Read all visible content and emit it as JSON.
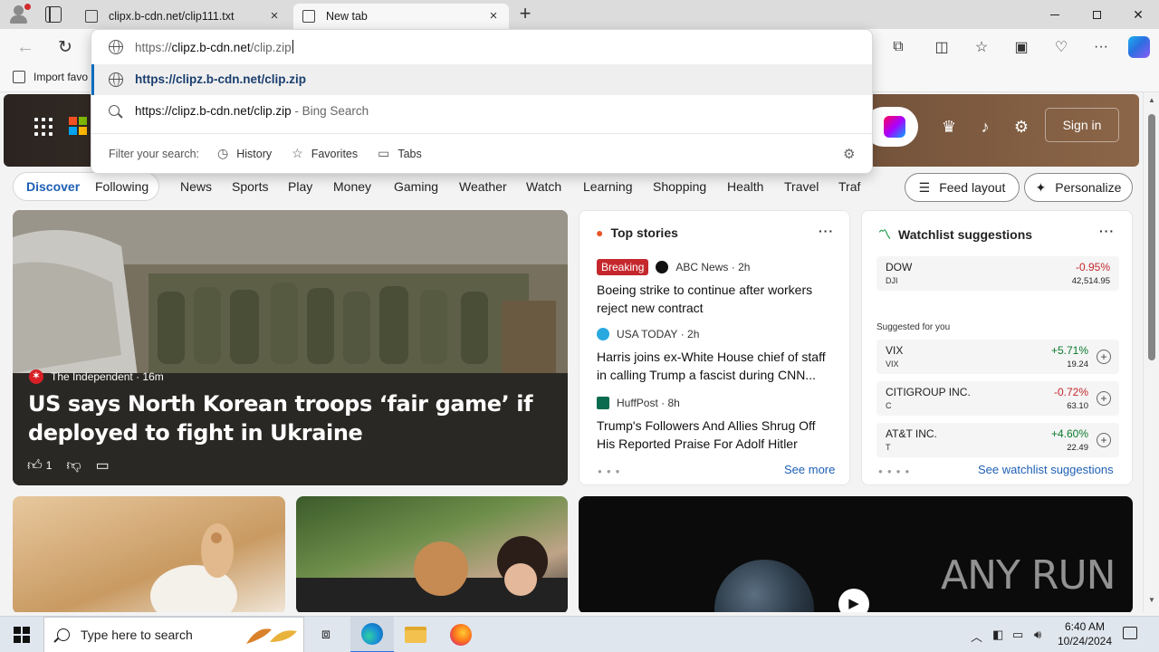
{
  "browser": {
    "tabs": [
      {
        "title": "clipx.b-cdn.net/clip111.txt"
      },
      {
        "title": "New tab"
      }
    ],
    "favorites_bar": {
      "import_label": "Import favo"
    },
    "address": {
      "prefix": "https://",
      "host": "clipz.b-cdn.net",
      "path": "/clip.zip"
    },
    "suggestions": [
      {
        "text": "https://clipz.b-cdn.net/clip.zip"
      },
      {
        "text": "https://clipz.b-cdn.net/clip.zip",
        "suffix": " - Bing Search"
      }
    ],
    "filter": {
      "label": "Filter your search:",
      "options": [
        "History",
        "Favorites",
        "Tabs"
      ]
    }
  },
  "page": {
    "sign_in": "Sign in",
    "feed_tabs": {
      "discover": "Discover",
      "following": "Following"
    },
    "categories": [
      "News",
      "Sports",
      "Play",
      "Money",
      "Gaming",
      "Weather",
      "Watch",
      "Learning",
      "Shopping",
      "Health",
      "Travel",
      "Traf"
    ],
    "buttons": {
      "feed_layout": "Feed layout",
      "personalize": "Personalize"
    },
    "hero": {
      "source": "The Independent",
      "age": "16m",
      "title": "US says North Korean troops ‘fair game’ if deployed to fight in Ukraine",
      "likes": "1"
    },
    "top_stories": {
      "heading": "Top stories",
      "items": [
        {
          "badge": "Breaking",
          "source": "ABC News",
          "age": "2h",
          "title": "Boeing strike to continue after workers reject new contract"
        },
        {
          "source": "USA TODAY",
          "age": "2h",
          "title": "Harris joins ex-White House chief of staff in calling Trump a fascist during CNN..."
        },
        {
          "source": "HuffPost",
          "age": "8h",
          "title": "Trump's Followers And Allies Shrug Off His Reported Praise For Adolf Hitler"
        }
      ],
      "see_more": "See more"
    },
    "watchlist": {
      "heading": "Watchlist suggestions",
      "suggested_label": "Suggested for you",
      "items": [
        {
          "name": "DOW",
          "symbol": "DJI",
          "change": "-0.95%",
          "price": "42,514.95"
        },
        {
          "name": "VIX",
          "symbol": "VIX",
          "change": "+5.71%",
          "price": "19.24"
        },
        {
          "name": "CITIGROUP INC.",
          "symbol": "C",
          "change": "-0.72%",
          "price": "63.10"
        },
        {
          "name": "AT&T INC.",
          "symbol": "T",
          "change": "+4.60%",
          "price": "22.49"
        }
      ],
      "see_link": "See watchlist suggestions"
    },
    "watermark": "ANY RUN"
  },
  "taskbar": {
    "search_placeholder": "Type here to search",
    "time": "6:40 AM",
    "date": "10/24/2024"
  },
  "colors": {
    "accent": "#1e5fb4",
    "negative": "#c4282d",
    "positive": "#0b7a2c"
  }
}
